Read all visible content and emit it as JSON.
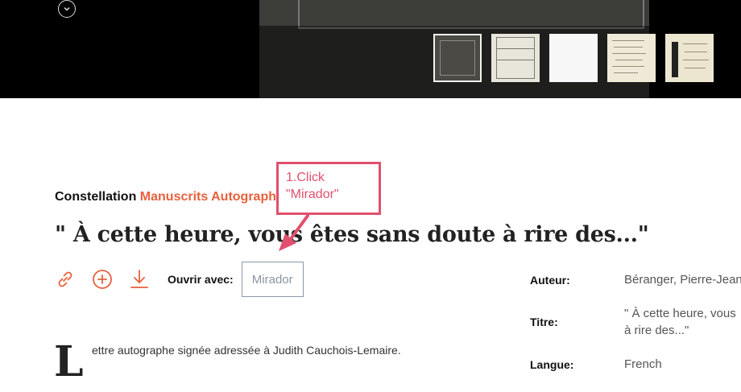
{
  "viewer": {
    "toggle_icon": "chevron-down-icon",
    "thumbnails": [
      {
        "label": "",
        "active": true
      },
      {
        "label": "",
        "active": false
      },
      {
        "label": "",
        "active": false
      },
      {
        "label": "",
        "active": false
      },
      {
        "label": "",
        "active": false
      }
    ]
  },
  "breadcrumb": {
    "prefix": "Constellation",
    "link": "Manuscrits Autographes"
  },
  "title": "\" À cette heure, vous êtes sans doute à rire des...\"",
  "actions": {
    "icons": [
      "link-icon",
      "add-icon",
      "download-icon"
    ],
    "open_with_label": "Ouvrir avec:",
    "mirador_label": "Mirador"
  },
  "description": {
    "drop_cap": "L",
    "text": "ettre autographe signée adressée à Judith Cauchois-Lemaire."
  },
  "metadata": {
    "author_label": "Auteur:",
    "author_value": "Béranger, Pierre-Jean",
    "title_label": "Titre:",
    "title_value_line1": "\" À cette heure, vous",
    "title_value_line2": "à rire des...\"",
    "language_label": "Langue:",
    "language_value": "French"
  },
  "annotation": {
    "line1": "1.Click",
    "line2": "\"Mirador\"",
    "color": "#e0506e"
  },
  "colors": {
    "accent": "#e8603c",
    "viewer_bg": "#000000"
  }
}
